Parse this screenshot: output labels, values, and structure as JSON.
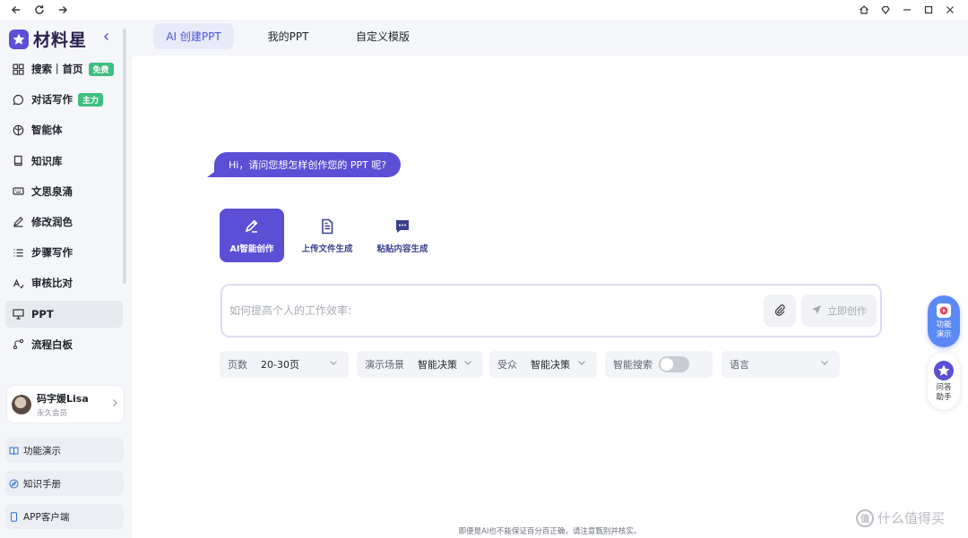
{
  "app": {
    "logo_text": "材料星"
  },
  "titlebar": {
    "back": "←",
    "refresh": "↻",
    "forward": "→",
    "home": "⌂",
    "minimize": "—",
    "maximize": "☐",
    "close": "✕"
  },
  "sidebar": {
    "items": [
      {
        "label": "搜索｜首页",
        "icon": "grid-icon",
        "badge": "免费"
      },
      {
        "label": "对话写作",
        "icon": "chat-icon",
        "badge": "主力"
      },
      {
        "label": "智能体",
        "icon": "agent-icon"
      },
      {
        "label": "知识库",
        "icon": "book-icon"
      },
      {
        "label": "文思泉涌",
        "icon": "keyboard-icon"
      },
      {
        "label": "修改润色",
        "icon": "pen-icon"
      },
      {
        "label": "步骤写作",
        "icon": "list-icon"
      },
      {
        "label": "审核比对",
        "icon": "compare-icon"
      },
      {
        "label": "PPT",
        "icon": "presentation-icon"
      },
      {
        "label": "流程白板",
        "icon": "flow-icon"
      }
    ],
    "user": {
      "name": "码字媛Lisa",
      "membership": "永久会员"
    },
    "bottom": [
      {
        "label": "功能演示",
        "icon": "book-open-icon"
      },
      {
        "label": "知识手册",
        "icon": "compass-icon"
      },
      {
        "label": "APP客户端",
        "icon": "phone-icon"
      }
    ]
  },
  "tabs": [
    {
      "label": "AI 创建PPT",
      "active": true
    },
    {
      "label": "我的PPT"
    },
    {
      "label": "自定义模版"
    }
  ],
  "main": {
    "greeting": "Hi，请问您想怎样创作您的 PPT 呢?",
    "modes": [
      {
        "label": "AI智能创作",
        "icon": "ai-pen-icon",
        "active": true
      },
      {
        "label": "上传文件生成",
        "icon": "document-icon"
      },
      {
        "label": "粘贴内容生成",
        "icon": "message-dots-icon"
      }
    ],
    "prompt_placeholder": "如何提高个人的工作效率:",
    "create_label": "立即创作",
    "options": {
      "pages_label": "页数",
      "pages_value": "20-30页",
      "scene_label": "演示场景",
      "scene_value": "智能决策",
      "audience_label": "受众",
      "audience_value": "智能决策",
      "smart_search_label": "智能搜索",
      "smart_search_on": false,
      "language_label": "语言"
    },
    "disclaimer": "即便是AI也不能保证百分百正确，请注意甄别并核实。"
  },
  "floating": {
    "demo_label_1": "功能",
    "demo_label_2": "演示",
    "help_label_1": "问答",
    "help_label_2": "助手"
  },
  "watermark": {
    "text": "什么值得买",
    "icon_text": "值"
  },
  "colors": {
    "accent": "#5b4fd6",
    "tab_active": "#4a56d8",
    "badge": "#3fbf7f",
    "float_demo": "#5b8af5"
  }
}
